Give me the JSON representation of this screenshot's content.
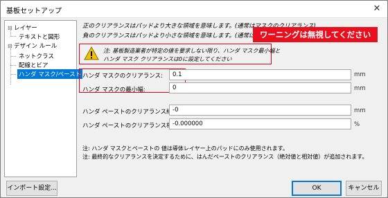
{
  "window": {
    "title": "基板セットアップ",
    "close_glyph": "✕"
  },
  "tree": {
    "items": [
      {
        "label": "レイヤー",
        "expander": "⊟"
      },
      {
        "label": "テキストと図形",
        "expander": ""
      },
      {
        "label": "デザイン ルール",
        "expander": "⊟"
      },
      {
        "label": "ネットクラス",
        "expander": ""
      },
      {
        "label": "配線とビア",
        "expander": ""
      },
      {
        "label": "ハンダ マスク/ペースト",
        "expander": ""
      }
    ],
    "selected_index": 5
  },
  "info": {
    "line1": "正のクリアランスはパッドより大きな領域を意味します。(通常はマスクのクリアランス)",
    "line2": "負のクリアランスはパッドより小さな領域を意味します。(通常はペーストのク"
  },
  "callout": {
    "text": "ワーニングは無視してください",
    "color": "#e8101f"
  },
  "warning": {
    "icon": "warning-triangle-icon",
    "line1": "注: 基板製造業者が特定の値を要求しない限り、ハンダ マスク最小幅と",
    "line2": "ハンダ マスク クリアランスは0に設定してください"
  },
  "fields": {
    "mask_clearance": {
      "label": "ハンダ マスクのクリアランス:",
      "value": "0.1",
      "unit": "mm"
    },
    "mask_min_width": {
      "label": "ハンダ マスクの最小幅:",
      "value": "0",
      "unit": "mm"
    },
    "paste_abs": {
      "label": "ハンダ ペーストのクリアランス絶対値:",
      "value": "-0",
      "unit": "mm"
    },
    "paste_rel": {
      "label": "ハンダ ペーストのクリアランス相対値:",
      "value": "-0.000000",
      "unit": "%"
    }
  },
  "notes": {
    "line1": "注: ハンダ マスクとペーストの 値は導体レイヤー上のパッドにのみ使用されます。",
    "line2": "注: 最終的なクリアランスを決定するために、はんだペーストのクリアランス（絶対値と相対値）が追加されます。"
  },
  "buttons": {
    "import": "インポート設定...",
    "ok": "OK",
    "cancel": "キャンセル"
  },
  "colors": {
    "accent": "#0078d7",
    "highlight_red": "#e0001a",
    "warning_yellow": "#f2c200"
  }
}
